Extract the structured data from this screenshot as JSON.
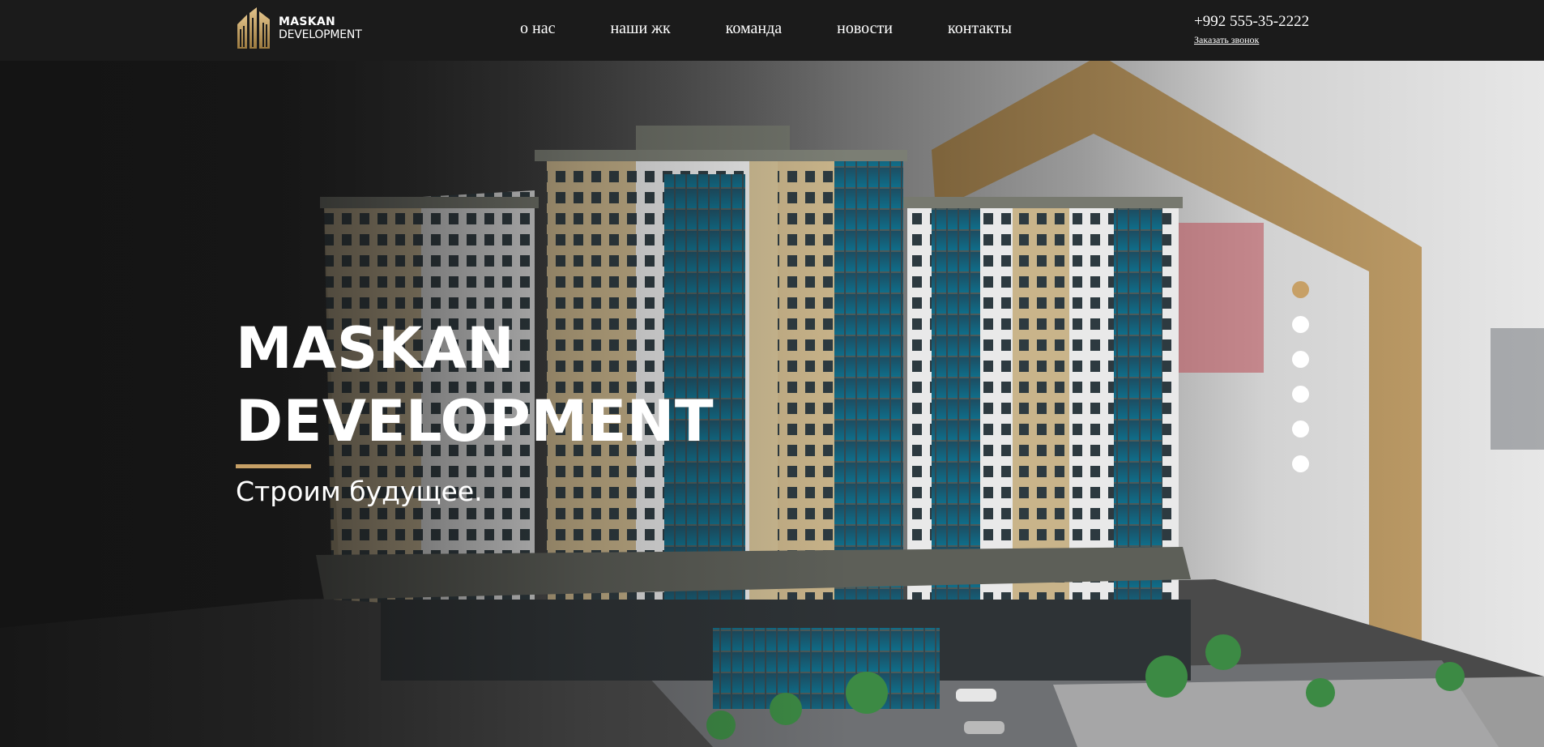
{
  "colors": {
    "accent": "#c7a066",
    "header_bg": "#1b1b1b",
    "text": "#ffffff"
  },
  "header": {
    "logo": {
      "line1": "MASKAN",
      "line2": "DEVELOPMENT"
    },
    "nav": [
      {
        "label": "о нас"
      },
      {
        "label": "наши жк"
      },
      {
        "label": "команда"
      },
      {
        "label": "новости"
      },
      {
        "label": "контакты"
      }
    ],
    "phone": "+992 555-35-2222",
    "callback": "Заказать звонок"
  },
  "hero": {
    "title_line1": "MASKAN",
    "title_line2": "DEVELOPMENT",
    "subtitle": "Строим будущее.",
    "slider": {
      "count": 6,
      "active_index": 0
    }
  }
}
